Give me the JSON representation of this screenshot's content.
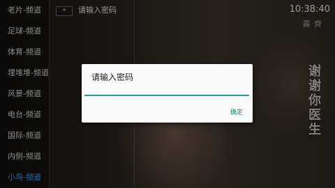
{
  "sidebar": {
    "items": [
      {
        "label": "老片-频道"
      },
      {
        "label": "足球-频道"
      },
      {
        "label": "体育-频道"
      },
      {
        "label": "埋堆堆-频道"
      },
      {
        "label": "风景-频道"
      },
      {
        "label": "电台-频道"
      },
      {
        "label": "国际-频道"
      },
      {
        "label": "内侧-频道"
      },
      {
        "label": "小鸟-频道"
      }
    ],
    "active_index": 8
  },
  "header": {
    "star_symbol": "*",
    "prompt": "请输入密码",
    "time": "10:38:40"
  },
  "background": {
    "watermark": "壽 齊",
    "vertical_title": "谢谢你医生"
  },
  "dialog": {
    "title": "请输入密码",
    "input_value": "",
    "ok_label": "确定"
  },
  "colors": {
    "accent": "#19a394",
    "active_item": "#4aa0e8"
  }
}
